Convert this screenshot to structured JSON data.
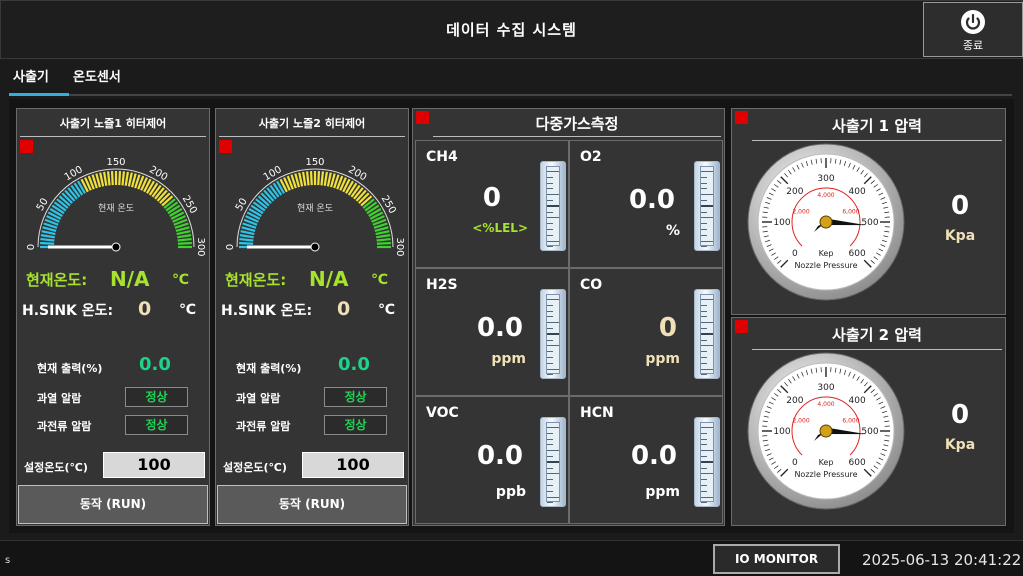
{
  "window": {
    "title": "데이터 수집 시스템",
    "exit_label": "종료"
  },
  "tabs": [
    {
      "label": "사출기"
    },
    {
      "label": "온도센서"
    }
  ],
  "heaters": [
    {
      "title": "사출기 노즐1 히터제어",
      "gauge_inner_label": "현재 온도",
      "ticks": [
        "0",
        "50",
        "100",
        "150",
        "200",
        "250",
        "300"
      ],
      "current_temp_label": "현재온도:",
      "current_temp_value": "N/A",
      "current_temp_unit": "℃",
      "hsink_label": "H.SINK 온도:",
      "hsink_value": "0",
      "hsink_unit": "℃",
      "output_label": "현재 출력(%)",
      "output_value": "0.0",
      "overheat_label": "과열 알람",
      "overheat_status": "정상",
      "overcurrent_label": "과전류 알람",
      "overcurrent_status": "정상",
      "setpoint_label": "설정온도(℃)",
      "setpoint_value": "100",
      "run_label": "동작 (RUN)"
    },
    {
      "title": "사출기 노즐2 히터제어",
      "gauge_inner_label": "현재 온도",
      "ticks": [
        "0",
        "50",
        "100",
        "150",
        "200",
        "250",
        "300"
      ],
      "current_temp_label": "현재온도:",
      "current_temp_value": "N/A",
      "current_temp_unit": "℃",
      "hsink_label": "H.SINK 온도:",
      "hsink_value": "0",
      "hsink_unit": "℃",
      "output_label": "현재 출력(%)",
      "output_value": "0.0",
      "overheat_label": "과열 알람",
      "overheat_status": "정상",
      "overcurrent_label": "과전류 알람",
      "overcurrent_status": "정상",
      "setpoint_label": "설정온도(℃)",
      "setpoint_value": "100",
      "run_label": "동작 (RUN)"
    }
  ],
  "gas": {
    "title": "다중가스측정",
    "sensors": [
      {
        "name": "CH4",
        "value": "0",
        "unit": "<%LEL>"
      },
      {
        "name": "O2",
        "value": "0.0",
        "unit": "%"
      },
      {
        "name": "H2S",
        "value": "0.0",
        "unit": "ppm"
      },
      {
        "name": "CO",
        "value": "0",
        "unit": "ppm"
      },
      {
        "name": "VOC",
        "value": "0.0",
        "unit": "ppb"
      },
      {
        "name": "HCN",
        "value": "0.0",
        "unit": "ppm"
      }
    ]
  },
  "pressure": [
    {
      "title": "사출기 1 압력",
      "value": "0",
      "unit": "Kpa",
      "dial_unit": "Kep",
      "dial_caption": "Nozzle Pressure",
      "outer_ticks": [
        "0",
        "100",
        "200",
        "300",
        "400",
        "500",
        "600"
      ],
      "inner_ticks": [
        "2,000",
        "4,000",
        "6,000"
      ]
    },
    {
      "title": "사출기 2 압력",
      "value": "0",
      "unit": "Kpa",
      "dial_unit": "Kep",
      "dial_caption": "Nozzle Pressure",
      "outer_ticks": [
        "0",
        "100",
        "200",
        "300",
        "400",
        "500",
        "600"
      ],
      "inner_ticks": [
        "2,000",
        "4,000",
        "6,000"
      ]
    }
  ],
  "status": {
    "left_text": "s",
    "io_monitor_label": "IO MONITOR",
    "datetime": "2025-06-13 20:41:22"
  },
  "colors": {
    "alarm": "#e00000",
    "ok": "#1fd255",
    "lime": "#a6e22e",
    "accent": "#2fb0e0"
  }
}
